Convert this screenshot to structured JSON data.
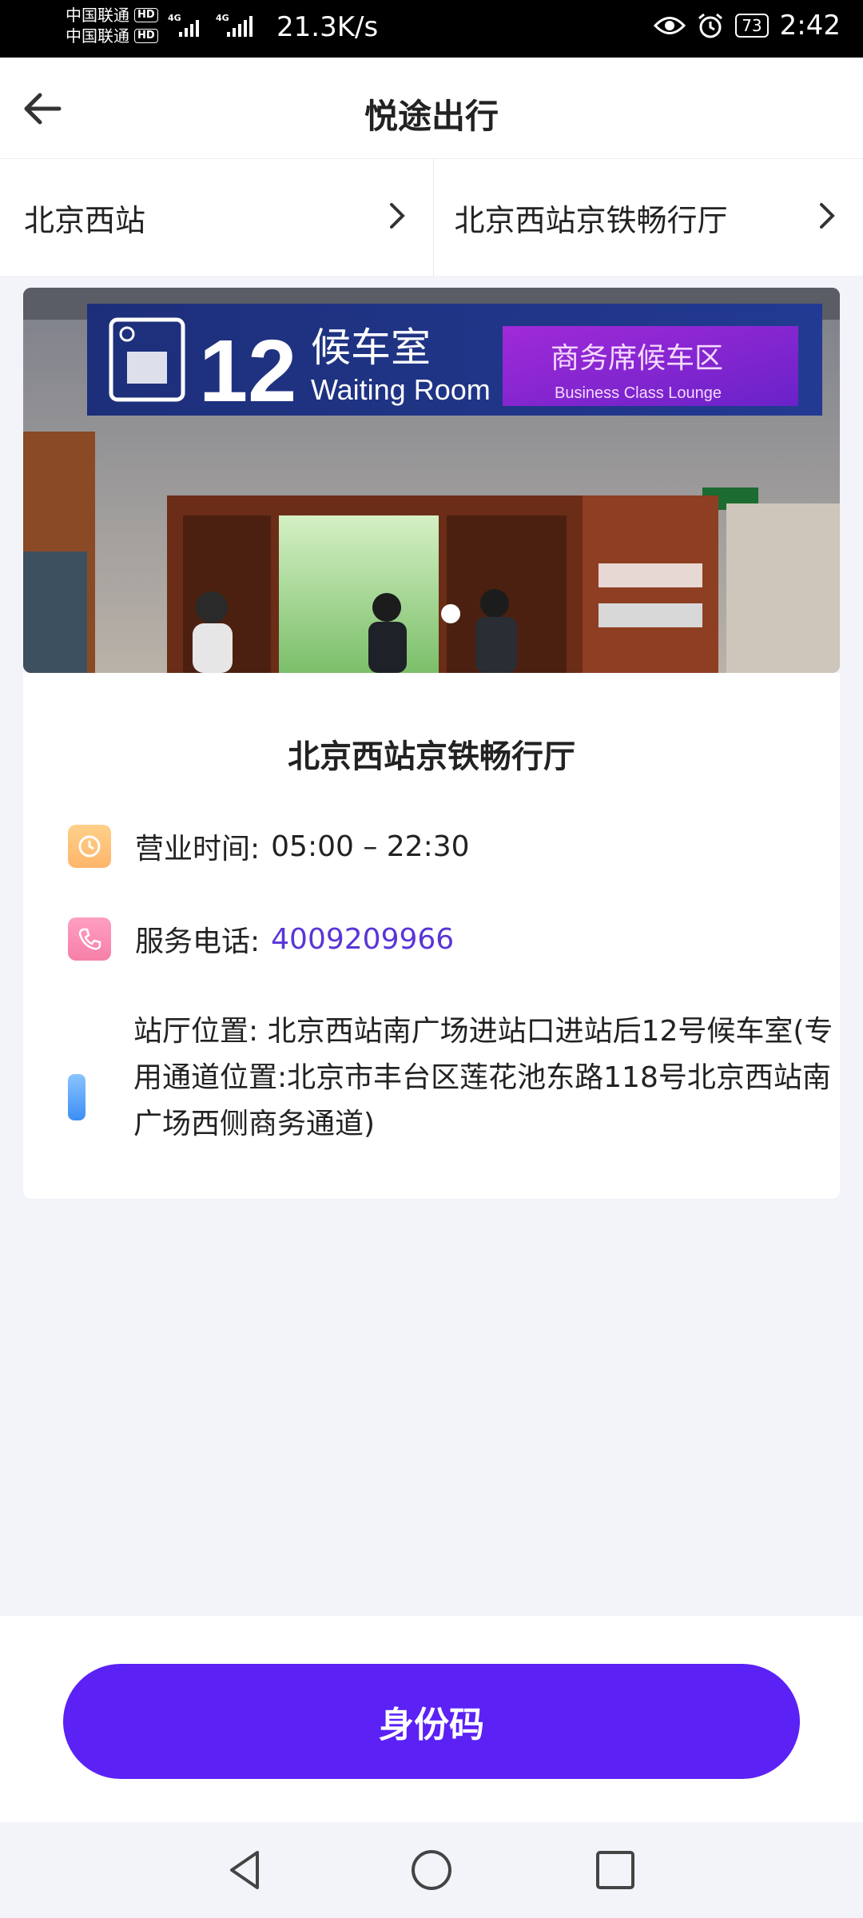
{
  "status_bar": {
    "carrier1": "中国联通",
    "carrier2": "中国联通",
    "hd_badge": "HD",
    "net_type": "4G",
    "speed": "21.3K/s",
    "battery": "73",
    "time": "2:42",
    "icons": [
      "eye-icon",
      "alarm-icon",
      "battery-icon"
    ]
  },
  "header": {
    "title": "悦途出行",
    "back_icon": "arrow-left-icon"
  },
  "tabs": [
    {
      "label": "北京西站",
      "icon": "chevron-right-icon"
    },
    {
      "label": "北京西站京铁畅行厅",
      "icon": "chevron-right-icon"
    }
  ],
  "banner": {
    "sign_number": "12",
    "sign_cn": "候车室",
    "sign_en": "Waiting Room",
    "led_cn": "商务席候车区",
    "led_en": "Business Class Lounge",
    "page_indicator": 1
  },
  "lounge": {
    "name": "北京西站京铁畅行厅",
    "hours_label": "营业时间:",
    "hours_value": "05:00 – 22:30",
    "phone_label": "服务电话:",
    "phone_value": "4009209966",
    "address_text": "站厅位置: 北京西站南广场进站口进站后12号候车室(专用通道位置:北京市丰台区莲花池东路118号北京西站南广场西侧商务通道)"
  },
  "action": {
    "button_label": "身份码"
  },
  "colors": {
    "accent": "#5b21f5",
    "phone": "#5a35d6",
    "clock_icon": "#fdb66b",
    "phone_icon": "#f67fa8",
    "pin_icon": "#5ea9fb"
  }
}
